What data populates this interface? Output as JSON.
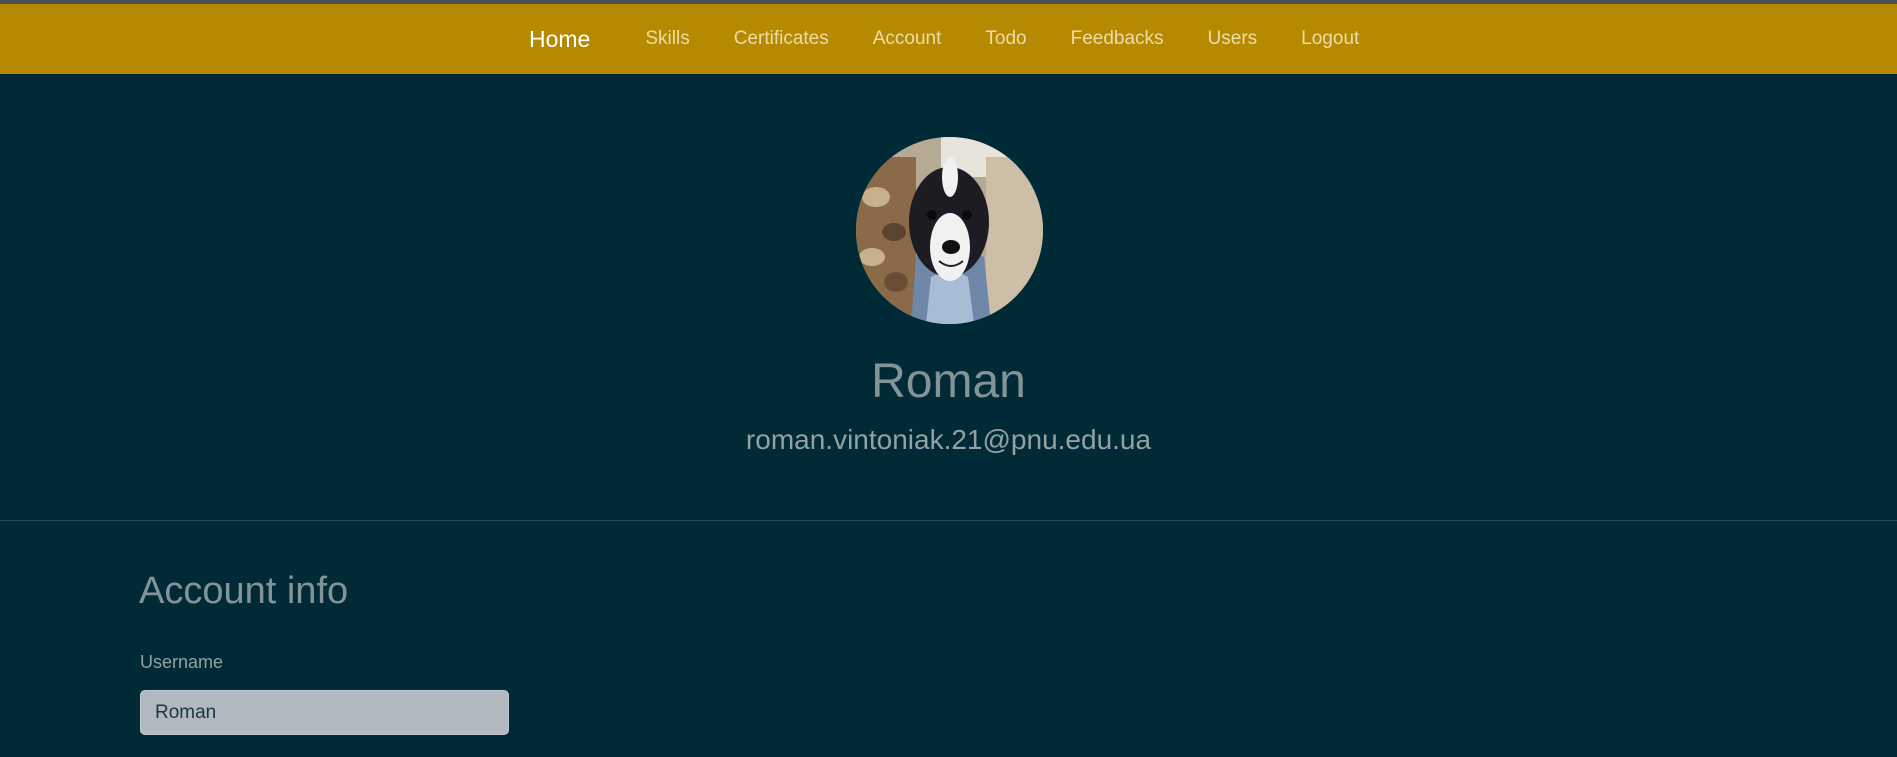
{
  "nav": {
    "brand": "Home",
    "links": [
      "Skills",
      "Certificates",
      "Account",
      "Todo",
      "Feedbacks",
      "Users",
      "Logout"
    ]
  },
  "profile": {
    "name": "Roman",
    "email": "roman.vintoniak.21@pnu.edu.ua"
  },
  "account_info": {
    "title": "Account info",
    "username_label": "Username",
    "username_value": "Roman"
  },
  "colors": {
    "navbar": "#b58900",
    "background": "#002b36",
    "text_muted": "#839496"
  }
}
